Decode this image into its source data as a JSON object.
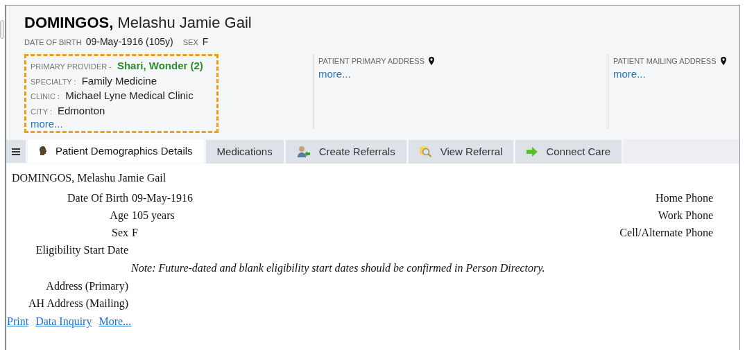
{
  "header": {
    "surname": "DOMINGOS,",
    "given_names": "Melashu Jamie Gail",
    "dob_label": "DATE OF BIRTH",
    "dob": "09-May-1916 (105y)",
    "sex_label": "SEX",
    "sex": "F"
  },
  "provider_box": {
    "highlighted": true,
    "fields": [
      {
        "kind": "provider",
        "label": "PRIMARY PROVIDER -",
        "value": "Shari, Wonder (2)"
      },
      {
        "kind": "plain",
        "label": "SPECIALTY :",
        "value": "Family Medicine"
      },
      {
        "kind": "plain",
        "label": "CLINIC :",
        "value": "Michael Lyne Medical Clinic"
      },
      {
        "kind": "plain",
        "label": "CITY :",
        "value": "Edmonton"
      }
    ],
    "more": "more..."
  },
  "addresses": [
    {
      "label": "PATIENT PRIMARY ADDRESS",
      "more": "more..."
    },
    {
      "label": "PATIENT MAILING ADDRESS",
      "more": "more..."
    }
  ],
  "tabs": [
    {
      "label": "Patient Demographics Details",
      "selected": true
    },
    {
      "label": "Medications",
      "selected": false
    },
    {
      "label": "Create Referrals",
      "selected": false
    },
    {
      "label": "View Referral",
      "selected": false
    },
    {
      "label": "Connect Care",
      "selected": false
    }
  ],
  "details": {
    "name": "DOMINGOS, Melashu Jamie Gail",
    "rows": [
      {
        "label": "Date Of Birth",
        "value": "09-May-1916",
        "right_label": "Home Phone"
      },
      {
        "label": "Age",
        "value": "105 years",
        "right_label": "Work Phone"
      },
      {
        "label": "Sex",
        "value": "F",
        "right_label": "Cell/Alternate Phone"
      },
      {
        "label": "Eligibility Start Date"
      }
    ],
    "note": "Note: Future-dated and blank eligibility start dates should be confirmed in Person Directory.",
    "address_rows": [
      {
        "label": "Address (Primary)"
      },
      {
        "label": "AH Address (Mailing)"
      }
    ],
    "links": [
      "Print",
      "Data Inquiry",
      "More..."
    ]
  }
}
